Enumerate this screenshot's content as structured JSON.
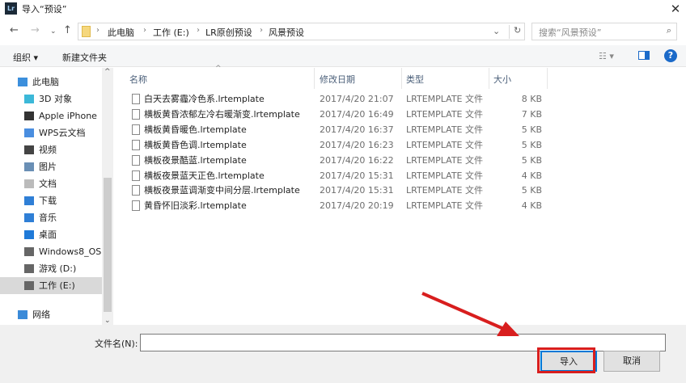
{
  "window": {
    "title": "导入“预设”",
    "app_icon": "Lr"
  },
  "address": {
    "path": [
      "此电脑",
      "工作 (E:)",
      "LR原创预设",
      "风景预设"
    ],
    "search_placeholder": "搜索“风景预设”"
  },
  "toolbar": {
    "organize": "组织 ▾",
    "new_folder": "新建文件夹",
    "help": "?"
  },
  "nav": [
    {
      "label": "此电脑",
      "icon": "computer-icon"
    },
    {
      "label": "3D 对象",
      "icon": "cube-icon"
    },
    {
      "label": "Apple iPhone",
      "icon": "phone-icon"
    },
    {
      "label": "WPS云文档",
      "icon": "cloud-icon"
    },
    {
      "label": "视频",
      "icon": "video-icon"
    },
    {
      "label": "图片",
      "icon": "picture-icon"
    },
    {
      "label": "文档",
      "icon": "document-icon"
    },
    {
      "label": "下载",
      "icon": "download-icon"
    },
    {
      "label": "音乐",
      "icon": "music-icon"
    },
    {
      "label": "桌面",
      "icon": "desktop-icon"
    },
    {
      "label": "Windows8_OS",
      "icon": "drive-icon"
    },
    {
      "label": "游戏 (D:)",
      "icon": "drive-icon"
    },
    {
      "label": "工作 (E:)",
      "icon": "drive-icon"
    },
    {
      "label": "网络",
      "icon": "network-icon"
    }
  ],
  "columns": {
    "name": "名称",
    "date": "修改日期",
    "type": "类型",
    "size": "大小"
  },
  "files": [
    {
      "name": "白天去雾霾冷色系.lrtemplate",
      "date": "2017/4/20 21:07",
      "type": "LRTEMPLATE 文件",
      "size": "8 KB"
    },
    {
      "name": "横板黄昏浓郁左冷右暖渐变.lrtemplate",
      "date": "2017/4/20 16:49",
      "type": "LRTEMPLATE 文件",
      "size": "7 KB"
    },
    {
      "name": "横板黄昏暖色.lrtemplate",
      "date": "2017/4/20 16:37",
      "type": "LRTEMPLATE 文件",
      "size": "5 KB"
    },
    {
      "name": "横板黄昏色调.lrtemplate",
      "date": "2017/4/20 16:23",
      "type": "LRTEMPLATE 文件",
      "size": "5 KB"
    },
    {
      "name": "横板夜景酷蓝.lrtemplate",
      "date": "2017/4/20 16:22",
      "type": "LRTEMPLATE 文件",
      "size": "5 KB"
    },
    {
      "name": "横板夜景蓝天正色.lrtemplate",
      "date": "2017/4/20 15:31",
      "type": "LRTEMPLATE 文件",
      "size": "4 KB"
    },
    {
      "name": "横板夜景蓝调渐变中间分层.lrtemplate",
      "date": "2017/4/20 15:31",
      "type": "LRTEMPLATE 文件",
      "size": "5 KB"
    },
    {
      "name": "黄昏怀旧淡彩.lrtemplate",
      "date": "2017/4/20 20:19",
      "type": "LRTEMPLATE 文件",
      "size": "4 KB"
    }
  ],
  "footer": {
    "filename_label": "文件名(N):",
    "filename_value": "",
    "import": "导入",
    "cancel": "取消"
  },
  "colors": {
    "accent": "#0078d7",
    "highlight": "#d81e1e"
  }
}
